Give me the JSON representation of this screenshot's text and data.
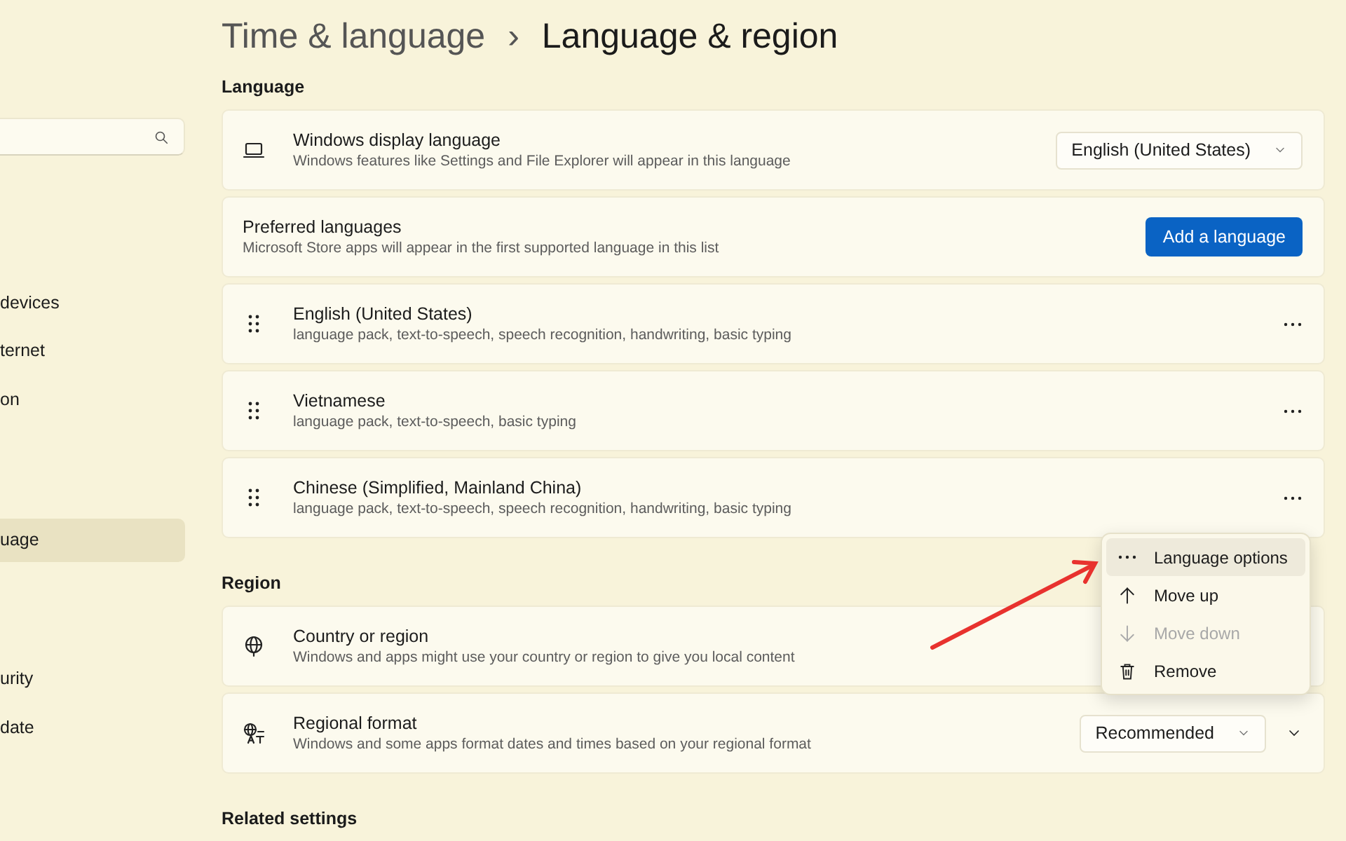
{
  "sidebar": {
    "items": [
      {
        "label": "devices",
        "selected": false
      },
      {
        "label": "ternet",
        "selected": false
      },
      {
        "label": "on",
        "selected": false
      },
      {
        "label": "uage",
        "selected": true
      },
      {
        "label": "urity",
        "selected": false
      },
      {
        "label": "date",
        "selected": false
      }
    ]
  },
  "breadcrumb": {
    "parent": "Time & language",
    "separator": "›",
    "current": "Language & region"
  },
  "sections": [
    {
      "title": "Language",
      "cards": [
        {
          "kind": "display",
          "title": "Windows display language",
          "description": "Windows features like Settings and File Explorer will appear in this language",
          "dropdown": "English (United States)"
        },
        {
          "kind": "preferred",
          "title": "Preferred languages",
          "description": "Microsoft Store apps will appear in the first supported language in this list",
          "button": "Add a language"
        },
        {
          "kind": "language",
          "title": "English (United States)",
          "description": "language pack, text-to-speech, speech recognition, handwriting, basic typing"
        },
        {
          "kind": "language",
          "title": "Vietnamese",
          "description": "language pack, text-to-speech, basic typing"
        },
        {
          "kind": "language",
          "title": "Chinese (Simplified, Mainland China)",
          "description": "language pack, text-to-speech, speech recognition, handwriting, basic typing"
        }
      ]
    },
    {
      "title": "Region",
      "cards": [
        {
          "kind": "country",
          "title": "Country or region",
          "description": "Windows and apps might use your country or region to give you local content"
        },
        {
          "kind": "format",
          "title": "Regional format",
          "description": "Windows and some apps format dates and times based on your regional format",
          "dropdown": "Recommended",
          "expanded": false
        }
      ]
    },
    {
      "title": "Related settings"
    }
  ],
  "context_menu": {
    "items": [
      {
        "kind": "options",
        "label": "Language options",
        "selected": true,
        "disabled": false
      },
      {
        "kind": "up",
        "label": "Move up",
        "selected": false,
        "disabled": false
      },
      {
        "kind": "down",
        "label": "Move down",
        "selected": false,
        "disabled": true
      },
      {
        "kind": "remove",
        "label": "Remove",
        "selected": false,
        "disabled": false
      }
    ]
  }
}
